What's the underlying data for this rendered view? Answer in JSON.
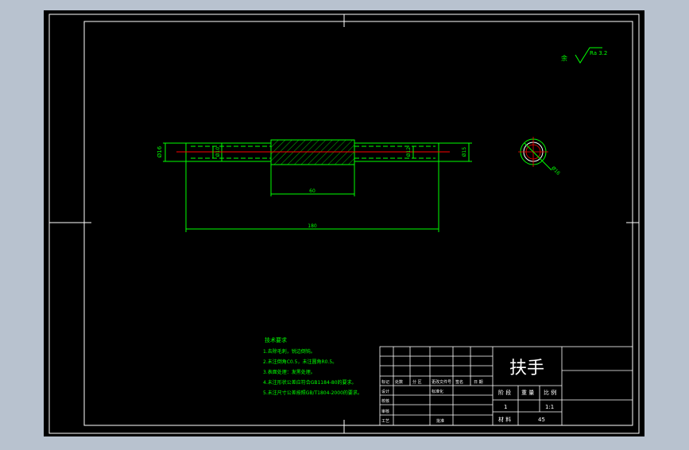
{
  "drawing": {
    "title_block_name": "扶手",
    "surface_finish": {
      "prefix": "余",
      "ra_value": "Ra 3.2"
    },
    "dimensions": {
      "left_diameter": "Ø16",
      "bore_left": "Ø10",
      "bore_right": "Ø12",
      "right_diameter": "Ø15",
      "middle_length": "60",
      "total_length": "180",
      "end_view_diameter": "Ø16"
    },
    "tech_requirements": {
      "heading": "技术要求",
      "items": [
        "1.去除毛刺，锐边倒钝。",
        "2.未注倒角C0.5，未注圆角R0.5。",
        "3.表面处理：发黑处理。",
        "4.未注形状公差应符合GB1184-80的要求。",
        "5.未注尺寸公差按照GB/T1804-2000的要求。"
      ]
    },
    "title_block": {
      "revision_headers": [
        "标记",
        "处数",
        "分 区",
        "更改文件号",
        "签名",
        "日 期"
      ],
      "row_labels": [
        "设计",
        "校核",
        "审核",
        "工艺"
      ],
      "std_label": "标准化",
      "approve_label": "批准",
      "stage_label": "阶 段",
      "weight_label": "重 量",
      "scale_label": "比 例",
      "scale_value": "1:1",
      "sheet_label": "共 张",
      "sheet_value": "1",
      "material_label": "材 料",
      "material_value": "45"
    }
  },
  "colors": {
    "outer_frame": "#ffffff",
    "geometry": "#00ff00",
    "centerline": "#ff0000",
    "hatch": "#00ff00",
    "text_white": "#ffffff"
  }
}
